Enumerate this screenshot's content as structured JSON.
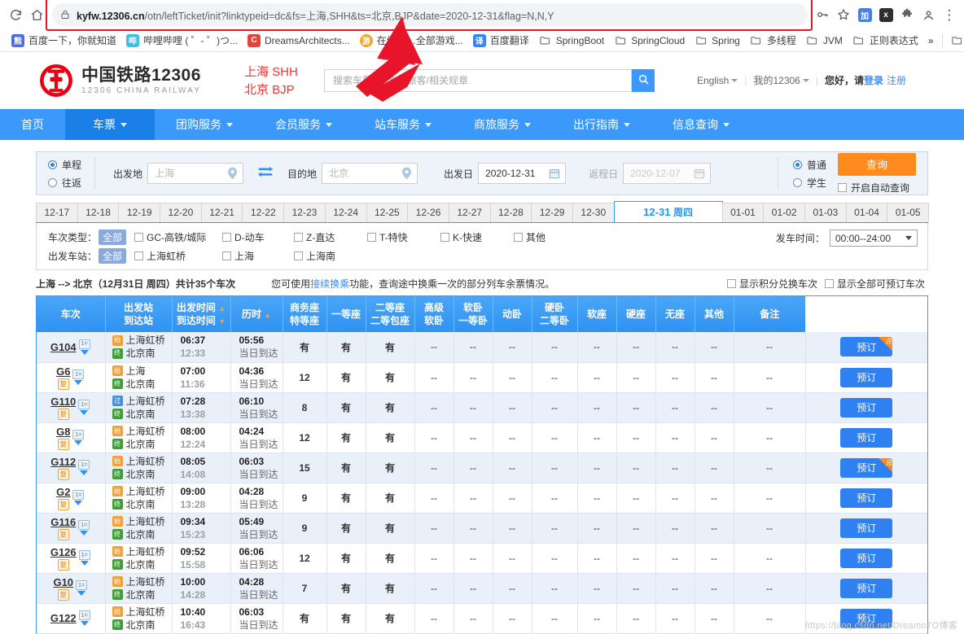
{
  "browser": {
    "reload_icon": "reload-icon",
    "home_icon": "home-icon",
    "lock_icon": "lock-icon",
    "url_host": "kyfw.12306.cn",
    "url_rest": "/otn/leftTicket/init?linktypeid=dc&fs=上海,SHH&ts=北京,BJP&date=2020-12-31&flag=N,N,Y",
    "url_full": "kyfw.12306.cn/otn/leftTicket/init?linktypeid=dc&fs=上海,SHH&ts=北京,BJP&date=2020-12-31&flag=N,N,Y",
    "highlight_color": "#e8152a",
    "right_icons": [
      {
        "name": "key-icon",
        "glyph": "⚿"
      },
      {
        "name": "bookmark-star-icon",
        "glyph": "☆"
      },
      {
        "name": "extension-jh-icon",
        "glyph": "加",
        "color": "#4a7fe0"
      },
      {
        "name": "extension-x-icon",
        "glyph": "x",
        "color": "#3a3a3a"
      },
      {
        "name": "extensions-puzzle-icon",
        "glyph": "🧩"
      },
      {
        "name": "profile-icon",
        "glyph": "●"
      },
      {
        "name": "more-menu-icon",
        "glyph": "⋮"
      }
    ],
    "bookmarks": [
      {
        "label": "百度一下，你就知道",
        "icon": "baidu-icon",
        "type": "site",
        "color": "#3385ff",
        "glyph": "熊"
      },
      {
        "label": "哔哩哔哩 ( ゜- ゜)つ...",
        "icon": "bilibili-icon",
        "type": "site",
        "color": "#4ac4e8",
        "glyph": "哔"
      },
      {
        "label": "DreamsArchitects...",
        "icon": "dreams-icon",
        "type": "site",
        "color": "#e8433a",
        "glyph": "C"
      },
      {
        "label": "在线直…全部游戏...",
        "icon": "game-icon",
        "type": "site",
        "color": "#f5a623",
        "glyph": "游"
      },
      {
        "label": "百度翻译",
        "icon": "fanyi-icon",
        "type": "site",
        "color": "#3385ff",
        "glyph": "译"
      },
      {
        "label": "SpringBoot",
        "icon": "folder-icon",
        "type": "folder"
      },
      {
        "label": "SpringCloud",
        "icon": "folder-icon",
        "type": "folder"
      },
      {
        "label": "Spring",
        "icon": "folder-icon",
        "type": "folder"
      },
      {
        "label": "多线程",
        "icon": "folder-icon",
        "type": "folder"
      },
      {
        "label": "JVM",
        "icon": "folder-icon",
        "type": "folder"
      },
      {
        "label": "正则表达式",
        "icon": "folder-icon",
        "type": "folder"
      }
    ],
    "bookmarks_overflow": "»",
    "other_bookmarks_icon": "folder-icon"
  },
  "site_header": {
    "logo_cn": "中国铁路12306",
    "logo_en": "12306 CHINA RAILWAY",
    "logo_color": "#e60012",
    "annotation": "上海 SHH\n北京 BJP",
    "annotation_line1": "上海 SHH",
    "annotation_line2": "北京 BJP",
    "annotation_color": "#ff2d2d",
    "search_placeholder": "搜索车票/餐饮/常旅客/相关规章",
    "search_value": "",
    "search_button_icon": "search-icon",
    "links": {
      "english": "English",
      "my12306": "我的12306",
      "greeting": "您好，请",
      "login": "登录",
      "register": "注册"
    }
  },
  "nav": {
    "accent": "#3b99fc",
    "items": [
      {
        "label": "首页",
        "has_caret": false,
        "active": false
      },
      {
        "label": "车票",
        "has_caret": true,
        "active": true
      },
      {
        "label": "团购服务",
        "has_caret": true,
        "active": false
      },
      {
        "label": "会员服务",
        "has_caret": true,
        "active": false
      },
      {
        "label": "站车服务",
        "has_caret": true,
        "active": false
      },
      {
        "label": "商旅服务",
        "has_caret": true,
        "active": false
      },
      {
        "label": "出行指南",
        "has_caret": true,
        "active": false
      },
      {
        "label": "信息查询",
        "has_caret": true,
        "active": false
      }
    ]
  },
  "search_panel": {
    "trip_single": "单程",
    "trip_round": "往返",
    "trip_selected": "单程",
    "from_label": "出发地",
    "from_value": "",
    "from_placeholder": "上海",
    "swap_icon": "swap-icon",
    "to_label": "目的地",
    "to_value": "",
    "to_placeholder": "北京",
    "depart_label": "出发日",
    "depart_value": "2020-12-31",
    "return_label": "返程日",
    "return_value": "",
    "return_placeholder": "2020-12-07",
    "calendar_icon": "calendar-icon",
    "passenger_normal": "普通",
    "passenger_student": "学生",
    "passenger_selected": "普通",
    "query_button": "查询",
    "query_button_color": "#ff8a1e",
    "auto_query": "开启自动查询",
    "auto_query_checked": false
  },
  "date_tabs": {
    "items": [
      "12-17",
      "12-18",
      "12-19",
      "12-20",
      "12-21",
      "12-22",
      "12-23",
      "12-24",
      "12-25",
      "12-26",
      "12-27",
      "12-28",
      "12-29",
      "12-30"
    ],
    "active": {
      "date": "12-31",
      "dow": "周四"
    },
    "items_after": [
      "01-01",
      "01-02",
      "01-03",
      "01-04",
      "01-05"
    ]
  },
  "filters": {
    "type_label": "车次类型：",
    "type_all": "全部",
    "types": [
      "GC-高铁/城际",
      "D-动车",
      "Z-直达",
      "T-特快",
      "K-快速",
      "其他"
    ],
    "station_label": "出发车站：",
    "station_all": "全部",
    "stations": [
      "上海虹桥",
      "上海",
      "上海南"
    ],
    "depart_time_label": "发车时间：",
    "depart_time_value": "00:00--24:00"
  },
  "summary": {
    "route": "上海 --> 北京",
    "date": "（12月31日 周四）",
    "count_prefix": "共计",
    "count": "35",
    "count_suffix": "个车次",
    "note_before": "您可使用",
    "note_link": "接续换乘",
    "note_after": "功能，查询途中换乘一次的部分列车余票情况。",
    "checkbox_points": "显示积分兑换车次",
    "checkbox_all": "显示全部可预订车次"
  },
  "table": {
    "headers": [
      {
        "lines": [
          "车次"
        ],
        "sort": null
      },
      {
        "lines": [
          "出发站",
          "到达站"
        ],
        "sort": null
      },
      {
        "lines": [
          "出发时间",
          "到达时间"
        ],
        "sort": "both"
      },
      {
        "lines": [
          "历时"
        ],
        "sort": "up"
      },
      {
        "lines": [
          "商务座",
          "特等座"
        ],
        "sort": null
      },
      {
        "lines": [
          "一等座"
        ],
        "sort": null
      },
      {
        "lines": [
          "二等座",
          "二等包座"
        ],
        "sort": null
      },
      {
        "lines": [
          "高级",
          "软卧"
        ],
        "sort": null
      },
      {
        "lines": [
          "软卧",
          "一等卧"
        ],
        "sort": null
      },
      {
        "lines": [
          "动卧"
        ],
        "sort": null
      },
      {
        "lines": [
          "硬卧",
          "二等卧"
        ],
        "sort": null
      },
      {
        "lines": [
          "软座"
        ],
        "sort": null
      },
      {
        "lines": [
          "硬座"
        ],
        "sort": null
      },
      {
        "lines": [
          "无座"
        ],
        "sort": null
      },
      {
        "lines": [
          "其他"
        ],
        "sort": null
      },
      {
        "lines": [
          "备注"
        ],
        "sort": null
      }
    ],
    "book_label": "预订",
    "exchange_badge": "兑",
    "arrive_same_day": "当日到达",
    "rows": [
      {
        "train": "G104",
        "has_fu": false,
        "from": "上海虹桥",
        "to": "北京南",
        "from_tag": "始",
        "from_tag_type": "shi",
        "to_tag": "终",
        "dep": "06:37",
        "arr": "12:33",
        "dur": "05:56",
        "seats": [
          "有",
          "有",
          "有",
          "--",
          "--",
          "--",
          "--",
          "--",
          "--",
          "--",
          "--",
          "--"
        ],
        "badge": true
      },
      {
        "train": "G6",
        "has_fu": true,
        "from": "上海",
        "to": "北京南",
        "from_tag": "始",
        "from_tag_type": "shi",
        "to_tag": "终",
        "dep": "07:00",
        "arr": "11:36",
        "dur": "04:36",
        "seats": [
          "12",
          "有",
          "有",
          "--",
          "--",
          "--",
          "--",
          "--",
          "--",
          "--",
          "--",
          "--"
        ],
        "badge": false
      },
      {
        "train": "G110",
        "has_fu": true,
        "from": "上海虹桥",
        "to": "北京南",
        "from_tag": "过",
        "from_tag_type": "blue",
        "to_tag": "终",
        "dep": "07:28",
        "arr": "13:38",
        "dur": "06:10",
        "seats": [
          "8",
          "有",
          "有",
          "--",
          "--",
          "--",
          "--",
          "--",
          "--",
          "--",
          "--",
          "--"
        ],
        "badge": false
      },
      {
        "train": "G8",
        "has_fu": true,
        "from": "上海虹桥",
        "to": "北京南",
        "from_tag": "始",
        "from_tag_type": "shi",
        "to_tag": "终",
        "dep": "08:00",
        "arr": "12:24",
        "dur": "04:24",
        "seats": [
          "12",
          "有",
          "有",
          "--",
          "--",
          "--",
          "--",
          "--",
          "--",
          "--",
          "--",
          "--"
        ],
        "badge": false
      },
      {
        "train": "G112",
        "has_fu": true,
        "from": "上海虹桥",
        "to": "北京南",
        "from_tag": "始",
        "from_tag_type": "shi",
        "to_tag": "终",
        "dep": "08:05",
        "arr": "14:08",
        "dur": "06:03",
        "seats": [
          "15",
          "有",
          "有",
          "--",
          "--",
          "--",
          "--",
          "--",
          "--",
          "--",
          "--",
          "--"
        ],
        "badge": true
      },
      {
        "train": "G2",
        "has_fu": true,
        "from": "上海虹桥",
        "to": "北京南",
        "from_tag": "始",
        "from_tag_type": "shi",
        "to_tag": "终",
        "dep": "09:00",
        "arr": "13:28",
        "dur": "04:28",
        "seats": [
          "9",
          "有",
          "有",
          "--",
          "--",
          "--",
          "--",
          "--",
          "--",
          "--",
          "--",
          "--"
        ],
        "badge": false
      },
      {
        "train": "G116",
        "has_fu": true,
        "from": "上海虹桥",
        "to": "北京南",
        "from_tag": "始",
        "from_tag_type": "shi",
        "to_tag": "终",
        "dep": "09:34",
        "arr": "15:23",
        "dur": "05:49",
        "seats": [
          "9",
          "有",
          "有",
          "--",
          "--",
          "--",
          "--",
          "--",
          "--",
          "--",
          "--",
          "--"
        ],
        "badge": false
      },
      {
        "train": "G126",
        "has_fu": true,
        "from": "上海虹桥",
        "to": "北京南",
        "from_tag": "始",
        "from_tag_type": "shi",
        "to_tag": "终",
        "dep": "09:52",
        "arr": "15:58",
        "dur": "06:06",
        "seats": [
          "12",
          "有",
          "有",
          "--",
          "--",
          "--",
          "--",
          "--",
          "--",
          "--",
          "--",
          "--"
        ],
        "badge": false
      },
      {
        "train": "G10",
        "has_fu": true,
        "from": "上海虹桥",
        "to": "北京南",
        "from_tag": "始",
        "from_tag_type": "shi",
        "to_tag": "终",
        "dep": "10:00",
        "arr": "14:28",
        "dur": "04:28",
        "seats": [
          "7",
          "有",
          "有",
          "--",
          "--",
          "--",
          "--",
          "--",
          "--",
          "--",
          "--",
          "--"
        ],
        "badge": false
      },
      {
        "train": "G122",
        "has_fu": false,
        "from": "上海虹桥",
        "to": "北京南",
        "from_tag": "始",
        "from_tag_type": "shi",
        "to_tag": "终",
        "dep": "10:40",
        "arr": "16:43",
        "dur": "06:03",
        "seats": [
          "有",
          "有",
          "有",
          "--",
          "--",
          "--",
          "--",
          "--",
          "--",
          "--",
          "--",
          "--"
        ],
        "badge": false
      }
    ]
  },
  "watermark": "https://blog.csdn.net/DreamoTO博客"
}
